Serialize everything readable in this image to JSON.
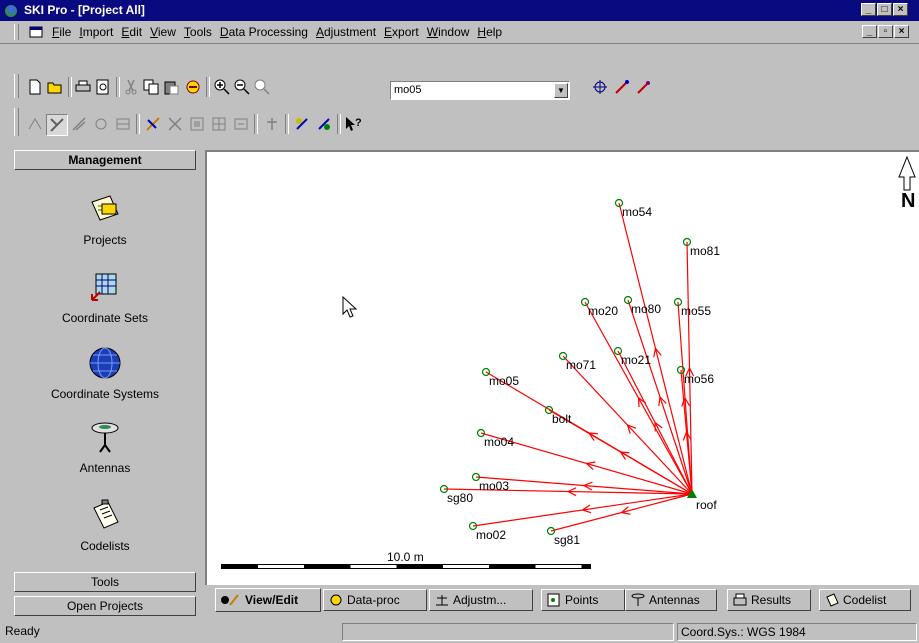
{
  "window": {
    "title": "SKI Pro - [Project All]"
  },
  "menu": {
    "items": [
      "File",
      "Import",
      "Edit",
      "View",
      "Tools",
      "Data Processing",
      "Adjustment",
      "Export",
      "Window",
      "Help"
    ]
  },
  "toolbar": {
    "point_combo_value": "mo05"
  },
  "sidebar": {
    "header": "Management",
    "items": [
      {
        "label": "Projects",
        "icon": "projects-icon"
      },
      {
        "label": "Coordinate Sets",
        "icon": "coordinate-sets-icon"
      },
      {
        "label": "Coordinate Systems",
        "icon": "globe-icon"
      },
      {
        "label": "Antennas",
        "icon": "antenna-icon"
      },
      {
        "label": "Codelists",
        "icon": "codelist-icon"
      }
    ],
    "footer_tools": "Tools",
    "footer_open_projects": "Open Projects"
  },
  "map": {
    "north_label": "N",
    "scale_label": "10.0 m",
    "base_station": "roof",
    "points": [
      {
        "name": "mo54"
      },
      {
        "name": "mo81"
      },
      {
        "name": "mo20"
      },
      {
        "name": "mo80"
      },
      {
        "name": "mo55"
      },
      {
        "name": "mo71"
      },
      {
        "name": "mo21"
      },
      {
        "name": "mo56"
      },
      {
        "name": "mo05"
      },
      {
        "name": "bolt"
      },
      {
        "name": "mo04"
      },
      {
        "name": "mo03"
      },
      {
        "name": "sg80"
      },
      {
        "name": "mo02"
      },
      {
        "name": "sg81"
      }
    ],
    "line_color": "#ff0000",
    "point_color": "#008000"
  },
  "tabs": [
    {
      "label": "View/Edit",
      "active": true
    },
    {
      "label": "Data-proc",
      "active": false
    },
    {
      "label": "Adjustm...",
      "active": false
    },
    {
      "label": "Points",
      "active": false
    },
    {
      "label": "Antennas",
      "active": false
    },
    {
      "label": "Results",
      "active": false
    },
    {
      "label": "Codelist",
      "active": false
    }
  ],
  "status": {
    "left": "Ready",
    "middle": "",
    "coord_sys": "Coord.Sys.: WGS 1984"
  }
}
